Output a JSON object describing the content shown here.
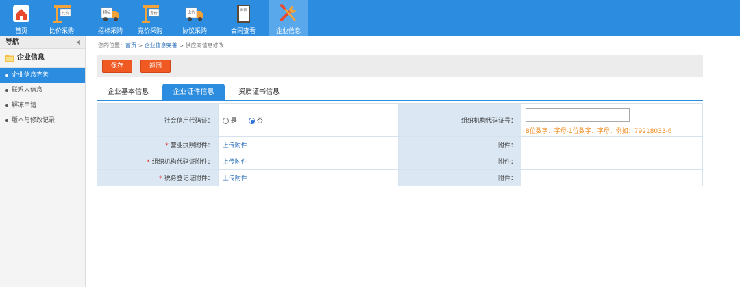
{
  "topnav": {
    "items": [
      {
        "label": "首页",
        "icon": "home-icon",
        "badge": ""
      },
      {
        "label": "比价采购",
        "icon": "crane-icon",
        "badge": "比价"
      },
      {
        "label": "招标采购",
        "icon": "truck-icon",
        "badge": "招标"
      },
      {
        "label": "竞价采购",
        "icon": "crane-icon",
        "badge": "竞价"
      },
      {
        "label": "协议采购",
        "icon": "truck-icon",
        "badge": "比价"
      },
      {
        "label": "合同查看",
        "icon": "contract-book-icon",
        "badge": "合同"
      },
      {
        "label": "企业信息",
        "icon": "wrench-screwdriver-icon",
        "badge": ""
      }
    ],
    "active_index": 6,
    "colors": {
      "bar": "#2b8ce0",
      "active": "#5aa8ec"
    }
  },
  "sidebar": {
    "title": "导航",
    "group": "企业信息",
    "items": [
      {
        "label": "企业信息完善",
        "active": true
      },
      {
        "label": "联系人信息",
        "active": false
      },
      {
        "label": "解冻申请",
        "active": false
      },
      {
        "label": "版本与修改记录",
        "active": false
      }
    ]
  },
  "breadcrumb": {
    "prefix": "您的位置：",
    "home": "首页",
    "sep1": " > ",
    "section": "企业信息完善",
    "sep2": " > ",
    "current": "供应商信息修改"
  },
  "toolbar": {
    "save_label": "保存",
    "back_label": "返回",
    "button_color": "#f05a22"
  },
  "tabs": [
    {
      "label": "企业基本信息",
      "active": false
    },
    {
      "label": "企业证件信息",
      "active": true
    },
    {
      "label": "资质证书信息",
      "active": false
    }
  ],
  "form": {
    "credit_code_label": "社会信用代码证：",
    "radio_yes": "是",
    "radio_no": "否",
    "selected": "否",
    "org_code_label": "组织机构代码证号：",
    "org_code_value": "",
    "org_code_hint": "8位数字、字母-1位数字、字母，例如：79218033-6",
    "required_mark": "*",
    "rows": [
      {
        "label": "营业执照附件：",
        "action": "上传附件",
        "attach_label": "附件："
      },
      {
        "label": "组织机构代码证附件：",
        "action": "上传附件",
        "attach_label": "附件："
      },
      {
        "label": "税务登记证附件：",
        "action": "上传附件",
        "attach_label": "附件："
      }
    ]
  }
}
